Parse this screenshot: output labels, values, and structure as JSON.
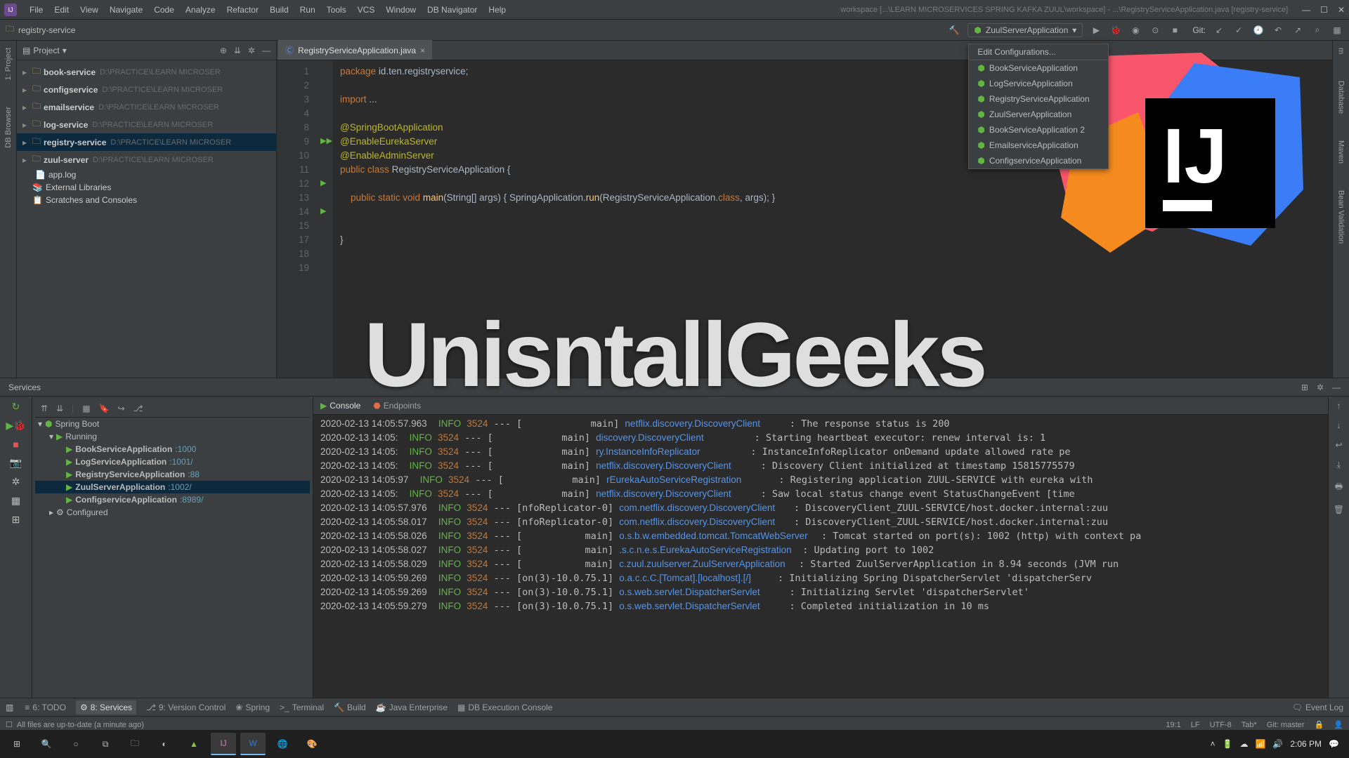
{
  "menubar": {
    "items": [
      "File",
      "Edit",
      "View",
      "Navigate",
      "Code",
      "Analyze",
      "Refactor",
      "Build",
      "Run",
      "Tools",
      "VCS",
      "Window",
      "DB Navigator",
      "Help"
    ],
    "title": "workspace [...\\LEARN MICROSERVICES SPRING KAFKA ZUUL\\workspace] - ...\\RegistryServiceApplication.java [registry-service]"
  },
  "breadcrumb": "registry-service",
  "run_config": {
    "selected": "ZuulServerApplication",
    "edit": "Edit Configurations...",
    "options": [
      "BookServiceApplication",
      "LogServiceApplication",
      "RegistryServiceApplication",
      "ZuulServerApplication",
      "BookServiceApplication 2",
      "EmailserviceApplication",
      "ConfigserviceApplication"
    ]
  },
  "vcs_label": "Git:",
  "left_vtabs": [
    "1: Project",
    "DB Browser"
  ],
  "right_vtabs": [
    "m",
    "Database",
    "Maven",
    "Bean Validation"
  ],
  "project": {
    "label": "Project",
    "items": [
      {
        "name": "book-service",
        "path": "D:\\PRACTICE\\LEARN MICROSER",
        "bold": true,
        "icon": "folder"
      },
      {
        "name": "configservice",
        "path": "D:\\PRACTICE\\LEARN MICROSER",
        "bold": true,
        "icon": "folder"
      },
      {
        "name": "emailservice",
        "path": "D:\\PRACTICE\\LEARN MICROSER",
        "bold": true,
        "icon": "folder"
      },
      {
        "name": "log-service",
        "path": "D:\\PRACTICE\\LEARN MICROSER",
        "bold": true,
        "icon": "folder"
      },
      {
        "name": "registry-service",
        "path": "D:\\PRACTICE\\LEARN MICROSER",
        "bold": true,
        "icon": "folder",
        "sel": true
      },
      {
        "name": "zuul-server",
        "path": "D:\\PRACTICE\\LEARN MICROSER",
        "bold": true,
        "icon": "folder"
      },
      {
        "name": "app.log",
        "path": "",
        "bold": false,
        "icon": "file",
        "indent": true
      },
      {
        "name": "External Libraries",
        "path": "",
        "bold": false,
        "icon": "lib"
      },
      {
        "name": "Scratches and Consoles",
        "path": "",
        "bold": false,
        "icon": "scratch"
      }
    ]
  },
  "editor": {
    "tab": "RegistryServiceApplication.java",
    "lines": [
      "1",
      "2",
      "3",
      "4",
      "8",
      "9",
      "10",
      "11",
      "12",
      "13",
      "14",
      "15",
      "17",
      "18",
      "19"
    ],
    "code": {
      "l1_pkg": "package",
      "l1_name": "id.ten.registryservice",
      "l3_imp": "import",
      "l3_rest": "...",
      "l9": "@SpringBootApplication",
      "l10": "@EnableEurekaServer",
      "l11": "@EnableAdminServer",
      "l12_pub": "public",
      "l12_cls": "class",
      "l12_name": "RegistryServiceApplication",
      "l12_br": "{",
      "l14_1": "public static void",
      "l14_fn": "main",
      "l14_2": "(String[] args)",
      "l14_3": "{",
      "l14_4": "SpringApplication.",
      "l14_5": "run",
      "l14_6": "(RegistryServiceApplication.",
      "l14_7": "class",
      "l14_8": ", args); }",
      "l18": "}"
    }
  },
  "services": {
    "title": "Services",
    "tree": {
      "root": "Spring Boot",
      "running": "Running",
      "configured": "Configured",
      "apps": [
        {
          "name": "BookServiceApplication",
          "port": ":1000"
        },
        {
          "name": "LogServiceApplication",
          "port": ":1001/"
        },
        {
          "name": "RegistryServiceApplication",
          "port": ":88"
        },
        {
          "name": "ZuulServerApplication",
          "port": ":1002/",
          "sel": true
        },
        {
          "name": "ConfigserviceApplication",
          "port": ":8989/"
        }
      ]
    },
    "console_tab": "Console",
    "endpoints_tab": "Endpoints",
    "log": [
      {
        "ts": "2020-02-13 14:05:57.963",
        "lv": "INFO",
        "pid": "3524",
        "th": "--- [            main]",
        "cl": "netflix.discovery.DiscoveryClient",
        "msg": ": The response status is 200"
      },
      {
        "ts": "2020-02-13 14:05:",
        "lv": "INFO",
        "pid": "3524",
        "th": "--- [            main]",
        "cl": "discovery.DiscoveryClient",
        "msg": ": Starting heartbeat executor: renew interval is: 1"
      },
      {
        "ts": "2020-02-13 14:05:",
        "lv": "INFO",
        "pid": "3524",
        "th": "--- [            main]",
        "cl": "ry.InstanceInfoReplicator",
        "msg": ": InstanceInfoReplicator onDemand update allowed rate pe"
      },
      {
        "ts": "2020-02-13 14:05:",
        "lv": "INFO",
        "pid": "3524",
        "th": "--- [            main]",
        "cl": "netflix.discovery.DiscoveryClient",
        "msg": ": Discovery Client initialized at timestamp 15815775579"
      },
      {
        "ts": "2020-02-13 14:05:97",
        "lv": "INFO",
        "pid": "3524",
        "th": "--- [            main]",
        "cl": "rEurekaAutoServiceRegistration",
        "msg": ": Registering application ZUUL-SERVICE with eureka with"
      },
      {
        "ts": "2020-02-13 14:05:",
        "lv": "INFO",
        "pid": "3524",
        "th": "--- [            main]",
        "cl": "netflix.discovery.DiscoveryClient",
        "msg": ": Saw local status change event StatusChangeEvent [time"
      },
      {
        "ts": "2020-02-13 14:05:57.976",
        "lv": "INFO",
        "pid": "3524",
        "th": "--- [nfoReplicator-0]",
        "cl": "com.netflix.discovery.DiscoveryClient",
        "msg": ": DiscoveryClient_ZUUL-SERVICE/host.docker.internal:zuu"
      },
      {
        "ts": "2020-02-13 14:05:58.017",
        "lv": "INFO",
        "pid": "3524",
        "th": "--- [nfoReplicator-0]",
        "cl": "com.netflix.discovery.DiscoveryClient",
        "msg": ": DiscoveryClient_ZUUL-SERVICE/host.docker.internal:zuu"
      },
      {
        "ts": "2020-02-13 14:05:58.026",
        "lv": "INFO",
        "pid": "3524",
        "th": "--- [           main]",
        "cl": "o.s.b.w.embedded.tomcat.TomcatWebServer",
        "msg": ": Tomcat started on port(s): 1002 (http) with context pa"
      },
      {
        "ts": "2020-02-13 14:05:58.027",
        "lv": "INFO",
        "pid": "3524",
        "th": "--- [           main]",
        "cl": ".s.c.n.e.s.EurekaAutoServiceRegistration",
        "msg": ": Updating port to 1002"
      },
      {
        "ts": "2020-02-13 14:05:58.029",
        "lv": "INFO",
        "pid": "3524",
        "th": "--- [           main]",
        "cl": "c.zuul.zuulserver.ZuulServerApplication",
        "msg": ": Started ZuulServerApplication in 8.94 seconds (JVM run"
      },
      {
        "ts": "2020-02-13 14:05:59.269",
        "lv": "INFO",
        "pid": "3524",
        "th": "--- [on(3)-10.0.75.1]",
        "cl": "o.a.c.c.C.[Tomcat].[localhost].[/]",
        "msg": ": Initializing Spring DispatcherServlet 'dispatcherServ"
      },
      {
        "ts": "2020-02-13 14:05:59.269",
        "lv": "INFO",
        "pid": "3524",
        "th": "--- [on(3)-10.0.75.1]",
        "cl": "o.s.web.servlet.DispatcherServlet",
        "msg": ": Initializing Servlet 'dispatcherServlet'"
      },
      {
        "ts": "2020-02-13 14:05:59.279",
        "lv": "INFO",
        "pid": "3524",
        "th": "--- [on(3)-10.0.75.1]",
        "cl": "o.s.web.servlet.DispatcherServlet",
        "msg": ": Completed initialization in 10 ms"
      }
    ]
  },
  "bottombar": {
    "items": [
      {
        "icon": "≡",
        "label": "6: TODO"
      },
      {
        "icon": "⚙",
        "label": "8: Services",
        "active": true
      },
      {
        "icon": "⎇",
        "label": "9: Version Control"
      },
      {
        "icon": "❀",
        "label": "Spring"
      },
      {
        "icon": ">_",
        "label": "Terminal"
      },
      {
        "icon": "🔨",
        "label": "Build"
      },
      {
        "icon": "☕",
        "label": "Java Enterprise"
      },
      {
        "icon": "▦",
        "label": "DB Execution Console"
      }
    ],
    "event_log": "Event Log"
  },
  "statusbar": {
    "msg": "All files are up-to-date (a minute ago)",
    "pos": "19:1",
    "lf": "LF",
    "enc": "UTF-8",
    "tab": "Tab*",
    "git": "Git: master"
  },
  "taskbar": {
    "time": "2:06 PM"
  },
  "watermark": "UnisntallGeeks"
}
